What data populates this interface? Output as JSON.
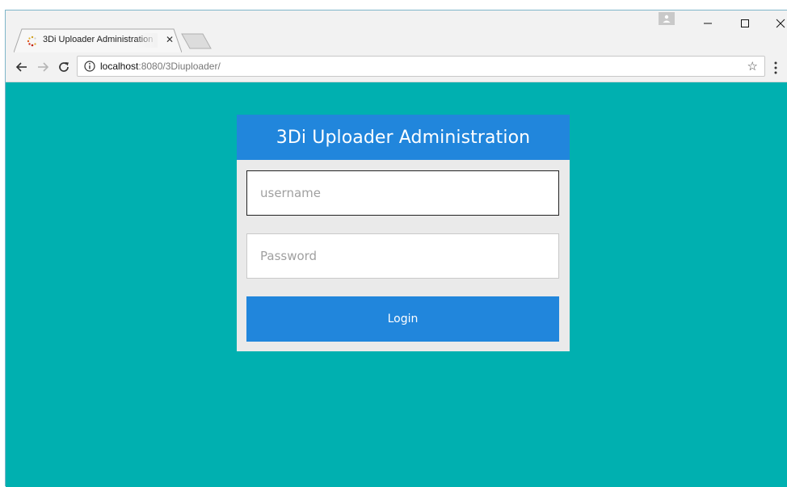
{
  "browser": {
    "tab": {
      "title": "3Di Uploader Administration",
      "close_glyph": "✕",
      "favicon": "loading-spinner-icon"
    },
    "window_controls": {
      "minimize_glyph": "—",
      "maximize_glyph": "☐",
      "close_glyph": "✕"
    },
    "address_bar": {
      "host": "localhost",
      "rest": ":8080/3Diuploader/",
      "bookmark_glyph": "☆"
    }
  },
  "page": {
    "title": "3Di Uploader Administration",
    "username_placeholder": "username",
    "username_value": "",
    "password_placeholder": "Password",
    "password_value": "",
    "login_label": "Login"
  },
  "colors": {
    "page_background": "#00b0b0",
    "header_background": "#2186dc",
    "button_background": "#2186dc",
    "card_background": "#eaeaea"
  }
}
